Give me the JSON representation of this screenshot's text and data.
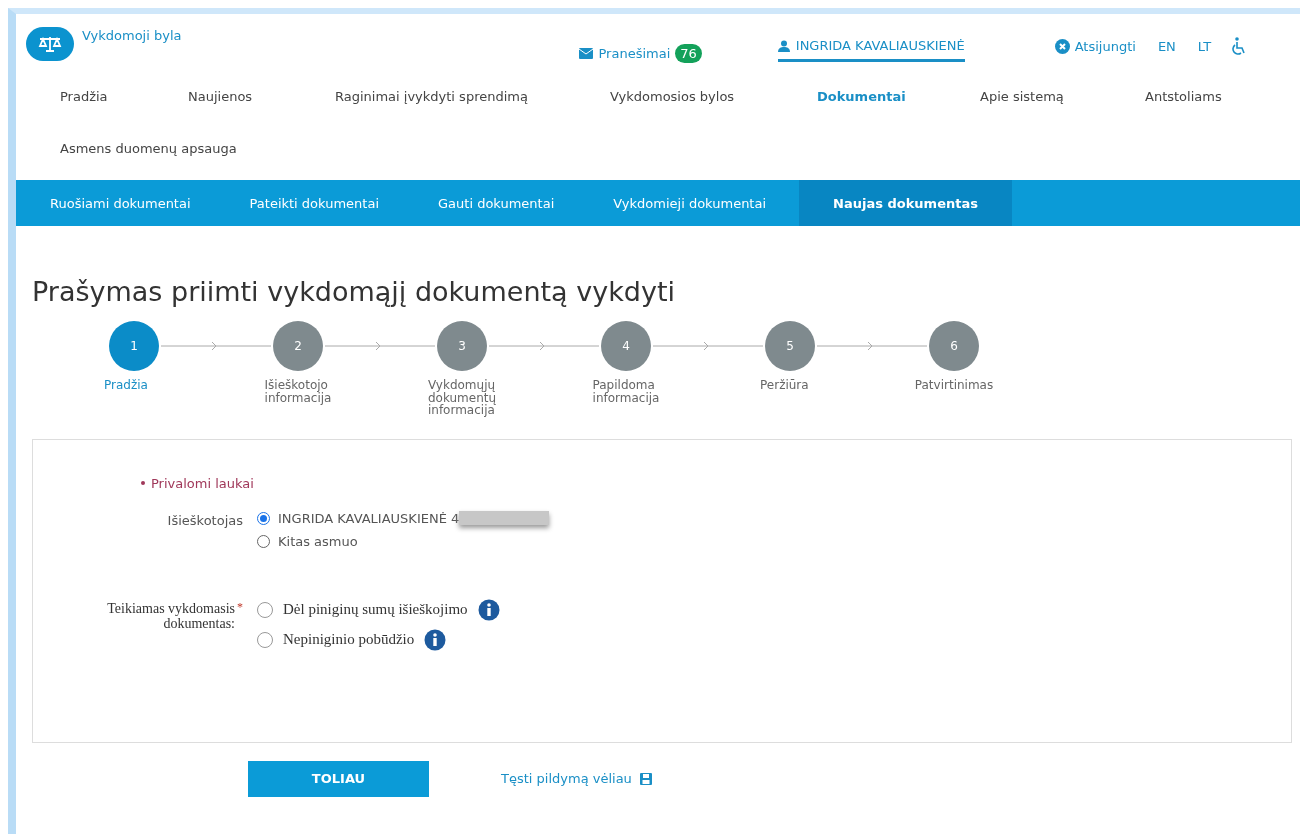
{
  "header": {
    "site_title": "Vykdomoji byla",
    "messages": {
      "label": "Pranešimai",
      "count": "76"
    },
    "user": {
      "name": "INGRIDA KAVALIAUSKIENĖ",
      "selected": true
    },
    "logout": "Atsijungti",
    "languages": [
      {
        "label": "EN",
        "selected": false
      },
      {
        "label": "LT",
        "selected": false
      }
    ]
  },
  "main_nav": [
    {
      "label": "Pradžia",
      "selected": false
    },
    {
      "label": "Naujienos",
      "selected": false
    },
    {
      "label": "Raginimai įvykdyti sprendimą",
      "selected": false
    },
    {
      "label": "Vykdomosios bylos",
      "selected": false
    },
    {
      "label": "Dokumentai",
      "selected": true
    },
    {
      "label": "Apie sistemą",
      "selected": false
    },
    {
      "label": "Antstoliams",
      "selected": false
    },
    {
      "label": "Asmens duomenų apsauga",
      "selected": false
    }
  ],
  "sub_nav": [
    {
      "label": "Ruošiami dokumentai",
      "selected": false
    },
    {
      "label": "Pateikti dokumentai",
      "selected": false
    },
    {
      "label": "Gauti dokumentai",
      "selected": false
    },
    {
      "label": "Vykdomieji dokumentai",
      "selected": false
    },
    {
      "label": "Naujas dokumentas",
      "selected": true
    }
  ],
  "page_title": "Prašymas priimti vykdomąjį dokumentą vykdyti",
  "steps": [
    {
      "number": "1",
      "label": "Pradžia",
      "selected": true
    },
    {
      "number": "2",
      "label": "Išieškotojo informacija",
      "selected": false
    },
    {
      "number": "3",
      "label": "Vykdomųjų dokumentų informacija",
      "selected": false
    },
    {
      "number": "4",
      "label": "Papildoma informacija",
      "selected": false
    },
    {
      "number": "5",
      "label": "Peržiūra",
      "selected": false
    },
    {
      "number": "6",
      "label": "Patvirtinimas",
      "selected": false
    }
  ],
  "form": {
    "required_note": "Privalomi laukai",
    "fields": [
      {
        "label": "Išieškotojas",
        "kind": "sans",
        "options": [
          {
            "label": "INGRIDA KAVALIAUSKIENĖ 4",
            "selected": true,
            "redacted": true,
            "info": false
          },
          {
            "label": "Kitas asmuo",
            "selected": false,
            "redacted": false,
            "info": false
          }
        ]
      },
      {
        "label": "Teikiamas vykdomasis dokumentas:",
        "required_mark": "*",
        "kind": "serif",
        "options": [
          {
            "label": "Dėl piniginų sumų išieškojimo",
            "selected": false,
            "redacted": false,
            "info": true
          },
          {
            "label": "Nepiniginio pobūdžio",
            "selected": false,
            "redacted": false,
            "info": true
          }
        ]
      }
    ]
  },
  "actions": {
    "next_button": "TOLIAU",
    "save_later_link": "Tęsti pildymą vėliau"
  }
}
